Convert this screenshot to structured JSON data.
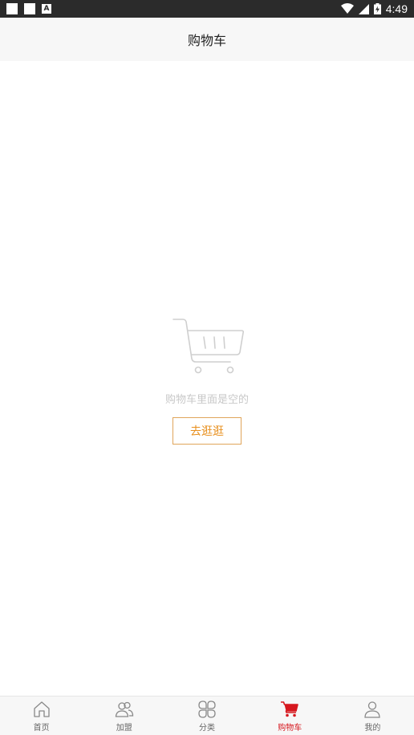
{
  "status_bar": {
    "time": "4:49",
    "notification_badge": "A"
  },
  "header": {
    "title": "购物车"
  },
  "empty_state": {
    "message": "购物车里面是空的",
    "button_label": "去逛逛"
  },
  "tabbar": {
    "active_color": "#d6181f",
    "items": [
      {
        "label": "首页",
        "icon": "home-icon"
      },
      {
        "label": "加盟",
        "icon": "users-icon"
      },
      {
        "label": "分类",
        "icon": "grid-petals-icon"
      },
      {
        "label": "购物车",
        "icon": "cart-icon",
        "active": true
      },
      {
        "label": "我的",
        "icon": "person-icon"
      }
    ]
  },
  "colors": {
    "accent_orange": "#e8901e",
    "active_red": "#d6181f",
    "status_bar": "#2b2b2b"
  }
}
